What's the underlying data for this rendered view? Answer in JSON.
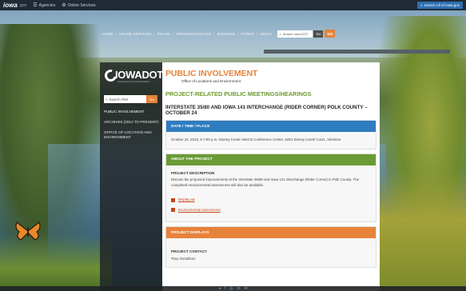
{
  "topbar": {
    "brand": "iowa",
    "brand_suffix": ".gov",
    "agencies": "Agencies",
    "online_services": "Online Services",
    "search_all": "Search All of Iowa.gov"
  },
  "nav": {
    "items": [
      "HOME",
      "ONLINE SERVICES",
      "TRAVEL",
      "DRIVERS/VEHICLES",
      "BUSINESS",
      "FORMS",
      "ABOUT"
    ],
    "search_placeholder": "Search Iowa DOT",
    "go": "Go",
    "c511": "511"
  },
  "sidebar": {
    "logo": "IOWADOT",
    "logo_tag": "Iowa Department of Transportation",
    "search_placeholder": "Search PIM",
    "go": "Go",
    "items": [
      "PUBLIC INVOLVEMENT",
      "ARCHIVES (2012 TO PRESENT)",
      "OFFICE OF LOCATION AND ENVIRONMENT"
    ]
  },
  "content": {
    "title": "PUBLIC INVOLVEMENT",
    "subtitle": "Office of Locations and Environment",
    "section": "PROJECT-RELATED PUBLIC MEETINGS/HEARINGS",
    "meeting_title": "INTERSTATE 35/80 AND IOWA 141 INTERCHANGE (RIDER CORNER) POLK COUNTY – OCTOBER 24",
    "date_header": "DATE / TIME / PLACE",
    "date_text": "October 24, 2016, 5-7:00 p.m. Stoney Creek Hotel & Conference Center, 5291 Stoney Creek Court, Johnston",
    "about_header": "ABOUT THE PROJECT",
    "desc_label": "PROJECT DESCRIPTION",
    "desc_text": "Discuss the proposed improvements at the Interstate 35/80 and Iowa 141 interchange (Rider Corner) in Polk County. The completed environmental assessment will also be available.",
    "doc1": "Display ad",
    "doc2": "Environmental assessment",
    "displays_header": "PROJECT DISPLAYS",
    "contact_label": "PROJECT CONTACT",
    "contact_name": "Tony Gustafson"
  },
  "colors": {
    "accent_orange": "#e7823a",
    "accent_green": "#6b9b35",
    "accent_blue": "#2f7cc0",
    "dark_panel": "#1e2226"
  }
}
